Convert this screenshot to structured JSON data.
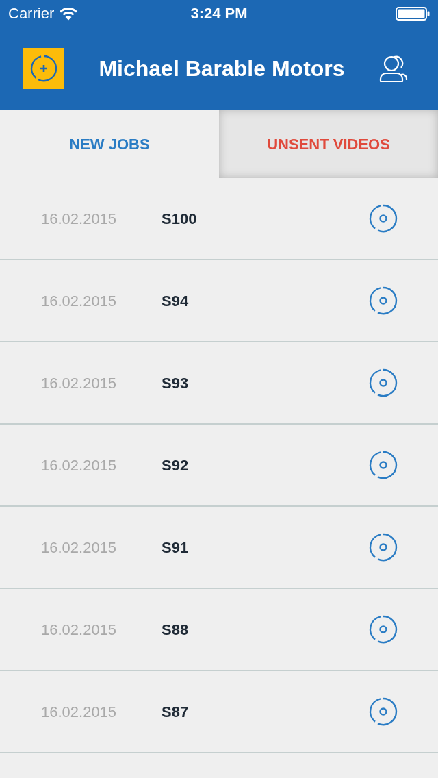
{
  "status_bar": {
    "carrier": "Carrier",
    "time": "3:24 PM"
  },
  "header": {
    "title": "Michael Barable Motors"
  },
  "tabs": [
    {
      "label": "NEW JOBS",
      "selected": true,
      "color": "#2a7cc4"
    },
    {
      "label": "UNSENT VIDEOS",
      "selected": false,
      "color": "#e04a3c"
    }
  ],
  "jobs": [
    {
      "date": "16.02.2015",
      "code": "S100"
    },
    {
      "date": "16.02.2015",
      "code": "S94"
    },
    {
      "date": "16.02.2015",
      "code": "S93"
    },
    {
      "date": "16.02.2015",
      "code": "S92"
    },
    {
      "date": "16.02.2015",
      "code": "S91"
    },
    {
      "date": "16.02.2015",
      "code": "S88"
    },
    {
      "date": "16.02.2015",
      "code": "S87"
    }
  ]
}
